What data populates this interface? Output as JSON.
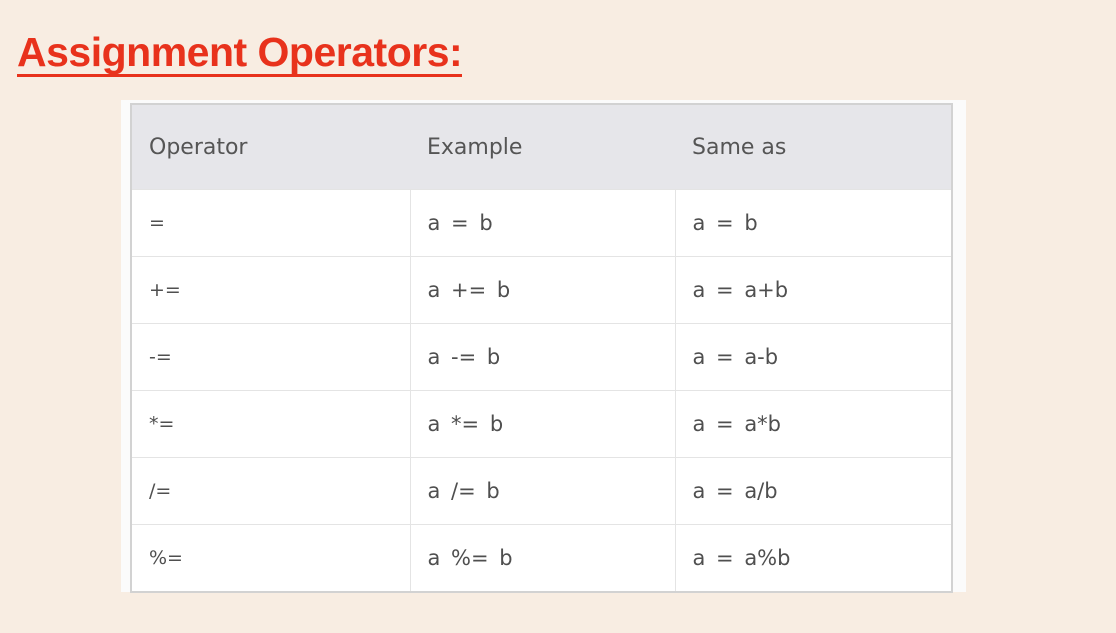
{
  "title": "Assignment Operators:",
  "table": {
    "headers": [
      "Operator",
      "Example",
      "Same as"
    ],
    "rows": [
      [
        "=",
        "a = b",
        "a = b"
      ],
      [
        "+=",
        "a += b",
        "a = a+b"
      ],
      [
        "-=",
        "a -= b",
        "a = a-b"
      ],
      [
        "*=",
        "a *= b",
        "a = a*b"
      ],
      [
        "/=",
        "a /= b",
        "a = a/b"
      ],
      [
        "%=",
        "a %= b",
        "a = a%b"
      ]
    ]
  }
}
